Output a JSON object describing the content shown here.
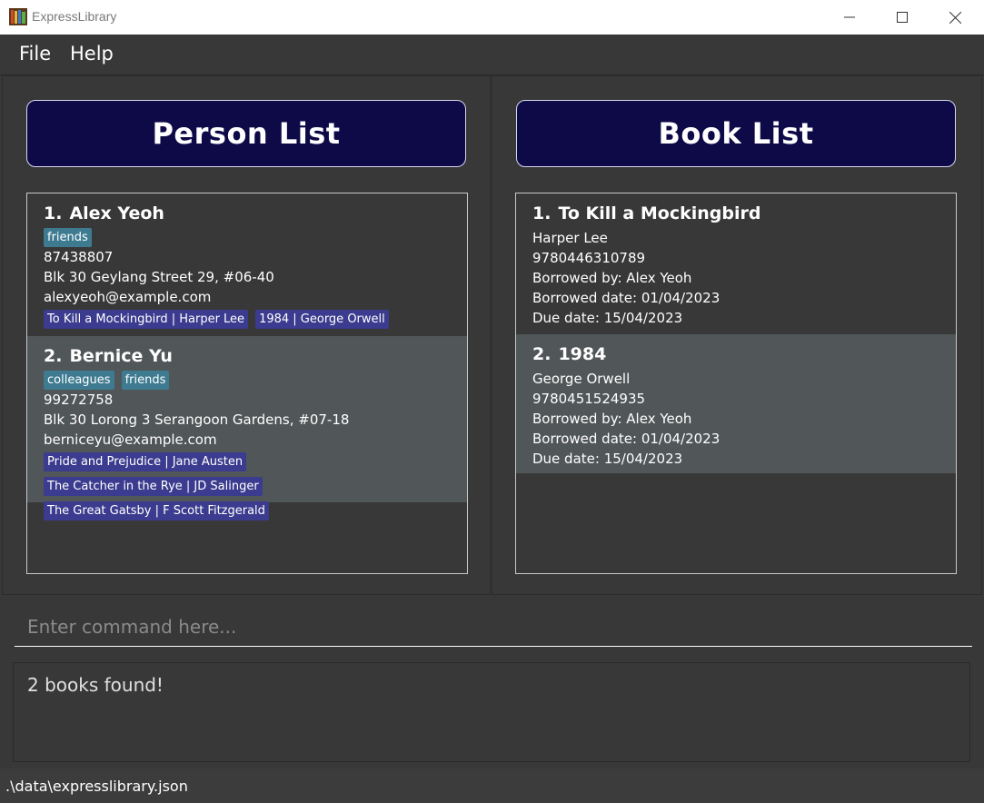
{
  "window": {
    "title": "ExpressLibrary",
    "icon": "books-icon"
  },
  "menu": {
    "file": "File",
    "help": "Help"
  },
  "person_panel": {
    "header": "Person List",
    "persons": [
      {
        "index": "1.",
        "name": "Alex Yeoh",
        "tags": [
          "friends"
        ],
        "phone": "87438807",
        "address": "Blk 30 Geylang Street 29, #06-40",
        "email": "alexyeoh@example.com",
        "books": [
          "To Kill a Mockingbird | Harper Lee",
          "1984 | George Orwell"
        ]
      },
      {
        "index": "2.",
        "name": "Bernice Yu",
        "tags": [
          "colleagues",
          "friends"
        ],
        "phone": "99272758",
        "address": "Blk 30 Lorong 3 Serangoon Gardens, #07-18",
        "email": "berniceyu@example.com",
        "books": [
          "Pride and Prejudice | Jane Austen",
          "The Catcher in the Rye | JD Salinger",
          "The Great Gatsby | F Scott Fitzgerald"
        ]
      }
    ]
  },
  "book_panel": {
    "header": "Book List",
    "books": [
      {
        "index": "1.",
        "title": "To Kill a Mockingbird",
        "author": "Harper Lee",
        "isbn": "9780446310789",
        "borrowed_by": "Borrowed by: Alex Yeoh",
        "borrowed_date": "Borrowed date: 01/04/2023",
        "due_date": "Due date: 15/04/2023"
      },
      {
        "index": "2.",
        "title": "1984",
        "author": "George Orwell",
        "isbn": "9780451524935",
        "borrowed_by": "Borrowed by: Alex Yeoh",
        "borrowed_date": "Borrowed date: 01/04/2023",
        "due_date": "Due date: 15/04/2023"
      }
    ]
  },
  "command": {
    "placeholder": "Enter command here...",
    "value": ""
  },
  "result": {
    "message": "2 books found!"
  },
  "status": {
    "file_path": ".\\data\\expresslibrary.json"
  },
  "colors": {
    "background": "#383838",
    "header_bg": "#0e0a48",
    "tag_bg": "#3e7b91",
    "book_tag_bg": "#3b3b8f",
    "alt_row_bg": "#515658"
  }
}
